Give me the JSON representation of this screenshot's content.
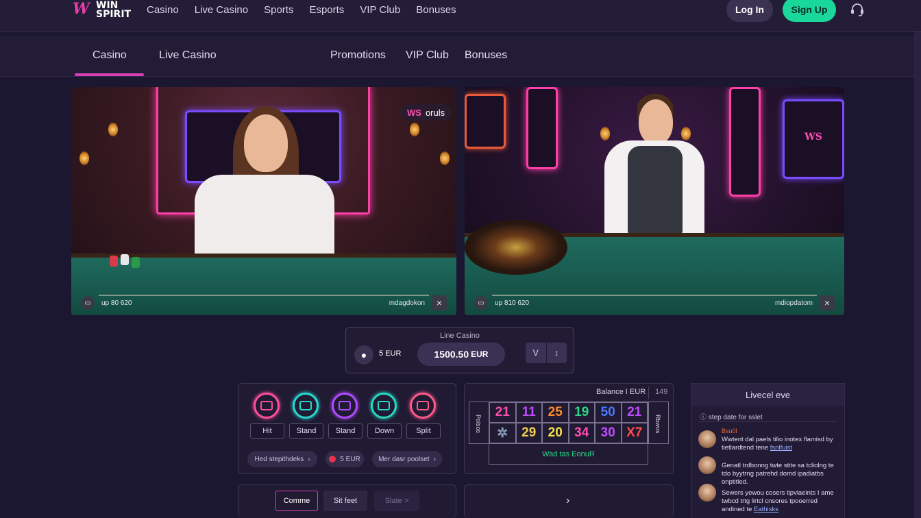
{
  "brand": {
    "mark": "W",
    "name": "WIN SPIRIT"
  },
  "top_nav": [
    "Casino",
    "Live Casino",
    "Sports",
    "Esports",
    "VIP Club",
    "Bonuses"
  ],
  "auth": {
    "login": "Log In",
    "signup": "Sign Up"
  },
  "sub_nav": {
    "tabs": [
      "Casino",
      "Live Casino",
      "Promotions",
      "VIP Club",
      "Bonuses"
    ],
    "active": "Casino"
  },
  "tiles": {
    "left": {
      "footer_left": "up 80 620",
      "footer_right": "mdagdokon",
      "overlay_mark": "WS",
      "overlay_label": "oruls"
    },
    "right": {
      "footer_left": "up 810 620",
      "footer_right": "mdiopdatom"
    }
  },
  "balance_bar": {
    "label": "Line Casino",
    "stake": "5 EUR",
    "balance": "1500.50",
    "currency": "EUR",
    "sort_down": "V",
    "sort_toggle": "↕"
  },
  "controls": {
    "actions": [
      "Hit",
      "Stand",
      "Stand",
      "Down",
      "Split"
    ],
    "ring_colors": [
      "#ff4f9a",
      "#27d9d0",
      "#b04cff",
      "#27d9c0",
      "#ff5a8a"
    ],
    "pills": [
      "Hed stepithdeks",
      "5 EUR",
      "Mer dasr poolset"
    ]
  },
  "board": {
    "balance_label": "Balance I EUR",
    "count": "149",
    "left_side": "Polsos",
    "right_side": "Rbwos",
    "row1": [
      {
        "n": "21",
        "c": "#ff4fb0"
      },
      {
        "n": "11",
        "c": "#c04cff"
      },
      {
        "n": "25",
        "c": "#ff8a2a"
      },
      {
        "n": "19",
        "c": "#27d986"
      },
      {
        "n": "50",
        "c": "#4a7cff"
      },
      {
        "n": "21",
        "c": "#c04cff"
      }
    ],
    "row2": [
      {
        "n": "✲",
        "c": "#8a9ab8"
      },
      {
        "n": "29",
        "c": "#f0d04a"
      },
      {
        "n": "20",
        "c": "#f0e04a"
      },
      {
        "n": "34",
        "c": "#ff4fb0"
      },
      {
        "n": "30",
        "c": "#c04cff"
      },
      {
        "n": "X7",
        "c": "#ff4a4a"
      }
    ],
    "footer": "Wad tas EonuR"
  },
  "chat": {
    "title": "Livecel eve",
    "note": "ⓘ step date for sslet",
    "messages": [
      {
        "name": "Bsu0l",
        "text": "Wwtent dal paels tilio inotex flamisd by tietlardtend tene ",
        "link": "fsnlfuist"
      },
      {
        "name": "",
        "text": "Genatl trdbonng twte stite sa tcliolng te tdo byytrng patrehd domd ipadiatbs onptitled.",
        "link": ""
      },
      {
        "name": "",
        "text": "Sewers yewou cosers tipvlaeints I ame twbcd trtg lirtcl cnsores tpooerred andined te ",
        "link": "Eathisks"
      }
    ]
  },
  "bottom": {
    "btn1": "Comme",
    "btn2": "Sit feet",
    "btn3": "Slate >",
    "arrow": "›"
  }
}
